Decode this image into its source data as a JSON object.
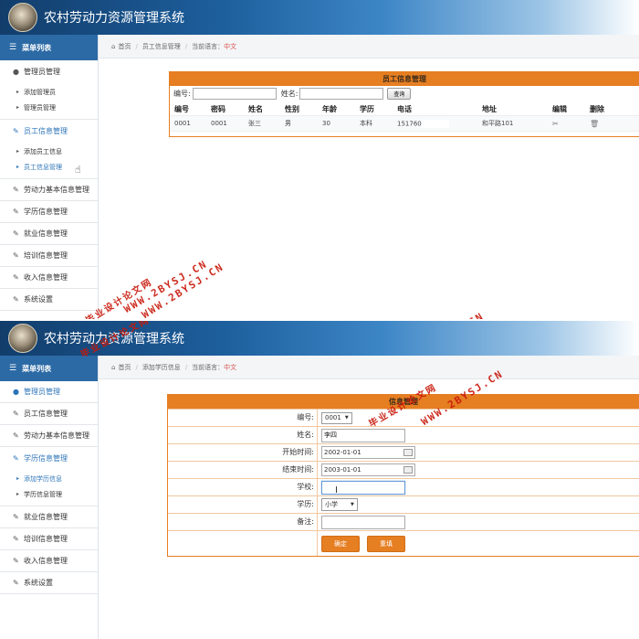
{
  "app_title": "农村劳动力资源管理系统",
  "sidebar_header": "菜单列表",
  "breadcrumb_home": "首页",
  "breadcrumb_lang_label": "当前语言：",
  "breadcrumb_lang_value": "中文",
  "screen1": {
    "breadcrumb_page": "员工信息管理",
    "sidebar": {
      "admin_group": "管理员管理",
      "admin_sub": [
        "添加管理员",
        "管理员管理"
      ],
      "employee_group": "员工信息管理",
      "employee_sub": [
        "添加员工信息",
        "员工信息管理"
      ],
      "items": [
        "劳动力基本信息管理",
        "学历信息管理",
        "就业信息管理",
        "培训信息管理",
        "收入信息管理",
        "系统设置"
      ]
    },
    "panel_title": "员工信息管理",
    "search": {
      "id_label": "编号:",
      "name_label": "姓名:",
      "button": "查询"
    },
    "table": {
      "headers": [
        "编号",
        "密码",
        "姓名",
        "性别",
        "年龄",
        "学历",
        "电话",
        "地址",
        "编辑",
        "删除"
      ],
      "rows": [
        [
          "0001",
          "0001",
          "张三",
          "男",
          "30",
          "本科",
          "1517608",
          "和平路101"
        ]
      ]
    }
  },
  "screen2": {
    "breadcrumb_page": "添加学历信息",
    "sidebar": {
      "admin_group": "管理员管理",
      "employee_group": "员工信息管理",
      "labor_group": "劳动力基本信息管理",
      "education_group": "学历信息管理",
      "education_sub": [
        "添加学历信息",
        "学历信息管理"
      ],
      "items": [
        "就业信息管理",
        "培训信息管理",
        "收入信息管理",
        "系统设置"
      ]
    },
    "panel_title": "信息管理",
    "form": {
      "id_label": "编号:",
      "id_value": "0001",
      "name_label": "姓名:",
      "name_value": "李四",
      "start_label": "开始时间:",
      "start_value": "2002-01-01",
      "end_label": "结束时间:",
      "end_value": "2003-01-01",
      "school_label": "学校:",
      "school_value": "",
      "degree_label": "学历:",
      "degree_value": "小学",
      "note_label": "备注:",
      "note_value": "",
      "submit": "确定",
      "reset": "重填"
    }
  },
  "watermarks": {
    "site": "WWW.2BYSJ.CN",
    "cn": "毕业设计论文网"
  }
}
